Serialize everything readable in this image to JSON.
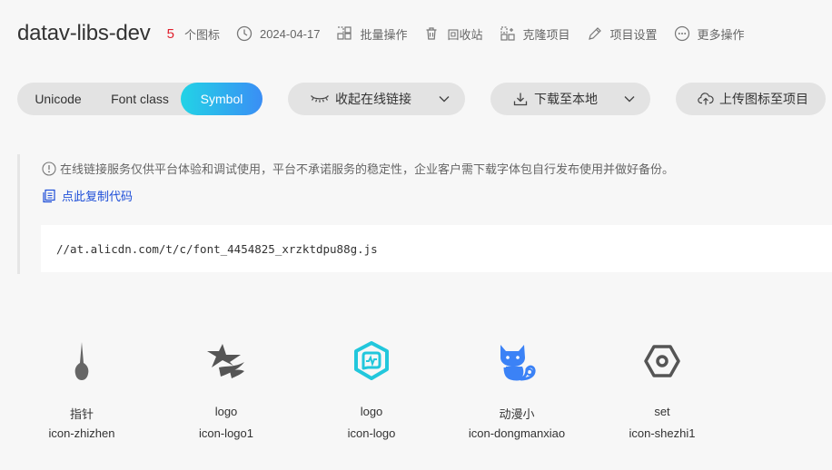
{
  "header": {
    "title": "datav-libs-dev",
    "count": "5",
    "count_label": "个图标",
    "date": "2024-04-17",
    "batch": "批量操作",
    "recycle": "回收站",
    "clone": "克隆项目",
    "settings": "项目设置",
    "more": "更多操作"
  },
  "toolbar": {
    "tabs": [
      "Unicode",
      "Font class",
      "Symbol"
    ],
    "active_tab": "Symbol",
    "collapse_link": "收起在线链接",
    "download": "下载至本地",
    "upload": "上传图标至项目"
  },
  "link": {
    "notice": "在线链接服务仅供平台体验和调试使用，平台不承诺服务的稳定性，企业客户需下载字体包自行发布使用并做好备份。",
    "copy": "点此复制代码",
    "code": "//at.alicdn.com/t/c/font_4454825_xrzktdpu88g.js"
  },
  "icons": [
    {
      "name": "指针",
      "code": "icon-zhizhen",
      "icon": "pointer-needle-icon",
      "color": "#666666"
    },
    {
      "name": "logo",
      "code": "icon-logo1",
      "icon": "star-logo-icon",
      "color": "#555555"
    },
    {
      "name": "logo",
      "code": "icon-logo",
      "icon": "hexagon-logo-icon",
      "color": "#22c7dc"
    },
    {
      "name": "动漫小",
      "code": "icon-dongmanxiao",
      "icon": "cat-icon",
      "color": "#3b82f6"
    },
    {
      "name": "set",
      "code": "icon-shezhi1",
      "icon": "hex-nut-icon",
      "color": "#555555"
    }
  ],
  "colors": {
    "accent_start": "#22d3e6",
    "accent_end": "#3a8ef5",
    "count": "#e0202e",
    "link": "#1d4ed8",
    "background": "#f7f7f7"
  }
}
